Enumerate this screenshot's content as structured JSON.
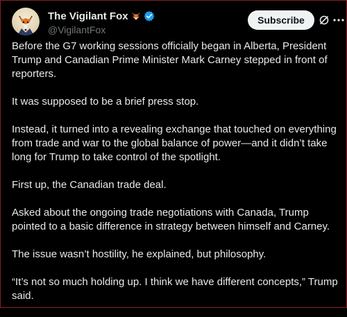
{
  "author": {
    "display_name": "The Vigilant Fox",
    "handle": "@VigilantFox",
    "emoji_icon": "fox-face-icon",
    "verified_icon": "verified-badge-icon"
  },
  "actions": {
    "subscribe_label": "Subscribe",
    "grok_icon": "grok-icon",
    "more_icon": "more-options-icon"
  },
  "post": {
    "paragraphs": [
      "Before the G7 working sessions officially began in Alberta, President Trump and Canadian Prime Minister Mark Carney stepped in front of reporters.",
      "It was supposed to be a brief press stop.",
      "Instead, it turned into a revealing exchange that touched on everything from trade and war to the global balance of power—and it didn’t take long for Trump to take control of the spotlight.",
      "First up, the Canadian trade deal.",
      "Asked about the ongoing trade negotiations with Canada, Trump pointed to a basic difference in strategy between himself and Carney.",
      "The issue wasn’t hostility, he explained, but philosophy.",
      "“It’s not so much holding up. I think we have different concepts,” Trump said."
    ]
  },
  "colors": {
    "background": "#000000",
    "text": "#e7e9ea",
    "muted": "#71767b",
    "verified": "#1d9bf0",
    "button_bg": "#eff3f4",
    "button_text": "#0f1419"
  }
}
